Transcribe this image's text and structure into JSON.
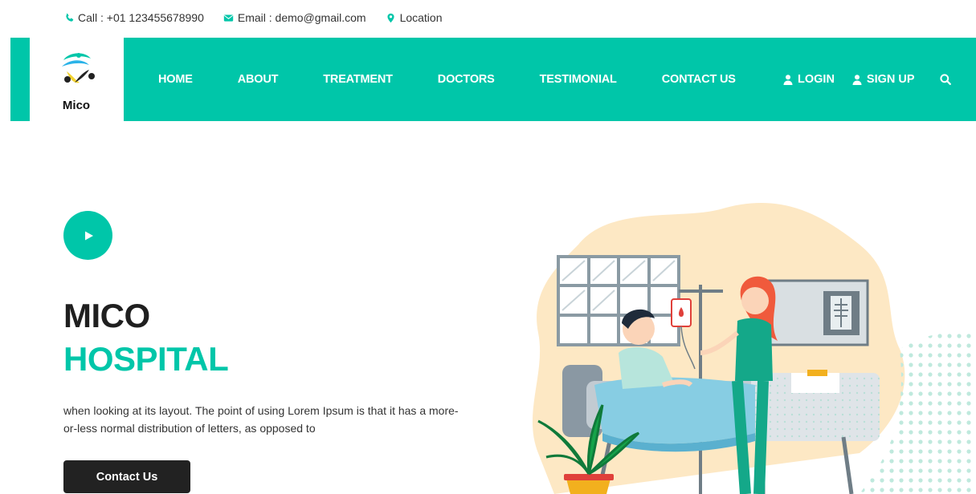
{
  "topbar": {
    "call": "Call : +01 123455678990",
    "email": "Email : demo@gmail.com",
    "location": "Location"
  },
  "brand": {
    "name": "Mico"
  },
  "nav": {
    "items": [
      "HOME",
      "ABOUT",
      "TREATMENT",
      "DOCTORS",
      "TESTIMONIAL",
      "CONTACT US"
    ],
    "login": "LOGIN",
    "signup": "SIGN UP"
  },
  "hero": {
    "title_line1": "MICO",
    "title_line2": "HOSPITAL",
    "description": "when looking at its layout. The point of using Lorem Ipsum is that it has a more-or-less normal distribution of letters, as opposed to",
    "cta_label": "Contact Us"
  },
  "colors": {
    "accent": "#00c6a9",
    "dark": "#222222",
    "text": "#333333"
  },
  "icons": {
    "call": "phone-icon",
    "email": "envelope-icon",
    "location": "map-marker-icon",
    "login": "user-icon",
    "signup": "user-icon",
    "search": "search-icon",
    "play": "play-icon"
  }
}
